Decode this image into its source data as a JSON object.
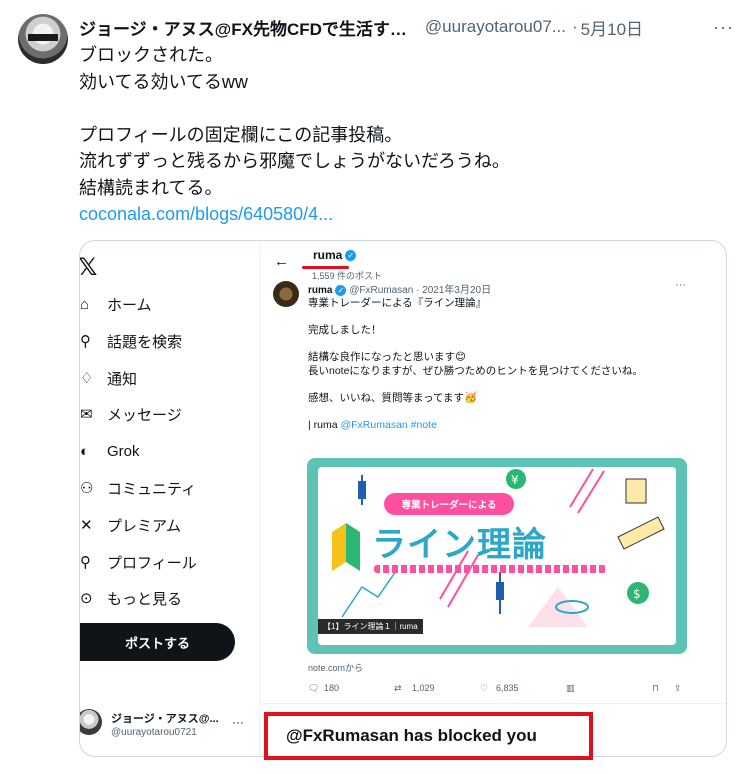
{
  "tweet": {
    "author_name": "ジョージ・アヌス@FX先物CFDで生活す…",
    "author_handle": "@uurayotarou07...",
    "separator": "·",
    "date": "5月10日",
    "more": "···",
    "lines": [
      "ブロックされた。",
      "効いてる効いてるww",
      "",
      "プロフィールの固定欄にこの記事投稿。",
      "流れずずっと残るから邪魔でしょうがないだろうね。",
      "結構読まれてる。"
    ],
    "link": "coconala.com/blogs/640580/4..."
  },
  "screenshot": {
    "nav": {
      "logo": "𝕏",
      "items": [
        {
          "icon": "home-icon",
          "glyph": "⌂",
          "label": "ホーム"
        },
        {
          "icon": "search-icon",
          "glyph": "⚲",
          "label": "話題を検索"
        },
        {
          "icon": "bell-icon",
          "glyph": "♢",
          "label": "通知"
        },
        {
          "icon": "mail-icon",
          "glyph": "✉",
          "label": "メッセージ"
        },
        {
          "icon": "grok-icon",
          "glyph": "◐",
          "label": "Grok"
        },
        {
          "icon": "community-icon",
          "glyph": "⚇",
          "label": "コミュニティ"
        },
        {
          "icon": "premium-icon",
          "glyph": "✕",
          "label": "プレミアム"
        },
        {
          "icon": "profile-icon",
          "glyph": "⚲",
          "label": "プロフィール"
        },
        {
          "icon": "more-icon",
          "glyph": "⊙",
          "label": "もっと見る"
        }
      ],
      "post_button": "ポストする",
      "account_name": "ジョージ・アヌス@...",
      "account_handle": "@uurayotarou0721",
      "account_more": "···"
    },
    "profile": {
      "back": "←",
      "name": "ruma",
      "post_count": "1,559 件のポスト"
    },
    "post": {
      "name": "ruma",
      "handle_date": "@FxRumasan · 2021年3月20日",
      "more": "···",
      "lines": [
        "専業トレーダーによる『ライン理論』",
        "",
        "完成しました！",
        "",
        "結構な良作になったと思います😊",
        "長いnoteになりますが、ぜひ勝つためのヒントを見つけてくださいね。",
        "",
        "感想、いいね、質問等まってます🥳",
        ""
      ],
      "link_prefix": "| ruma ",
      "link_text": "@FxRumasan #note",
      "banner_pill": "専業トレーダーによる",
      "banner_title": "ライン理論",
      "banner_label": "【1】ライン理論１｜ruma",
      "source": "note.comから",
      "replies": "180",
      "reposts": "1,029",
      "likes": "6,835"
    },
    "blocked_message": "@FxRumasan has blocked you"
  },
  "colors": {
    "link": "#1d9bf0",
    "highlight_red": "#e0101d",
    "banner_teal": "#5ec3b4",
    "banner_pink": "#ff4fa0",
    "banner_blue": "#2aa7c9"
  }
}
